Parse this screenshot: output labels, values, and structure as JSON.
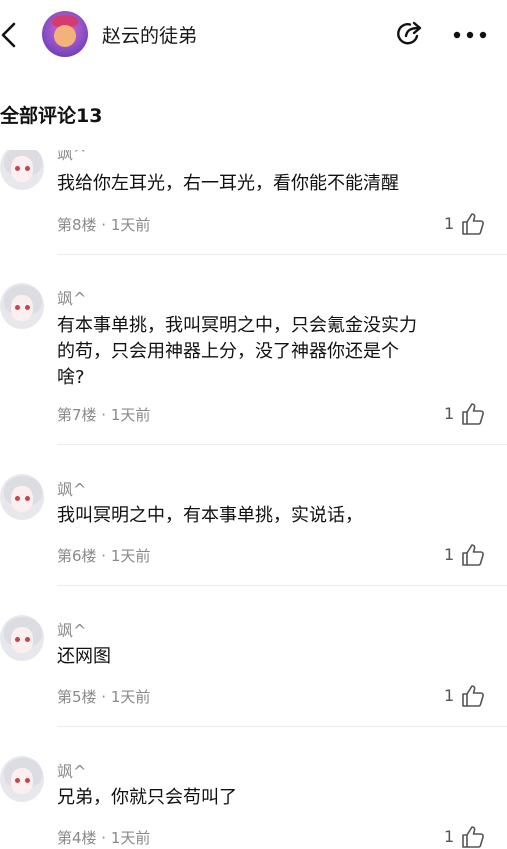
{
  "header": {
    "title": "赵云的徒弟"
  },
  "section": {
    "title": "全部评论13"
  },
  "comments": [
    {
      "user": "飒^",
      "text": "我给你左耳光，右一耳光，看你能不能清醒",
      "floor": "第8楼 · 1天前",
      "likes": "1"
    },
    {
      "user": "飒^",
      "text_lines": [
        "有本事单挑，我叫冥明之中，只会氪金没实力",
        "的苟，只会用神器上分，没了神器你还是个",
        "啥?"
      ],
      "floor": "第7楼 · 1天前",
      "likes": "1"
    },
    {
      "user": "飒^",
      "text": "我叫冥明之中，有本事单挑，实说话，",
      "floor": "第6楼 · 1天前",
      "likes": "1"
    },
    {
      "user": "飒^",
      "text": "还网图",
      "floor": "第5楼 · 1天前",
      "likes": "1"
    },
    {
      "user": "飒^",
      "text": "兄弟，你就只会苟叫了",
      "floor": "第4楼 · 1天前",
      "likes": "1"
    }
  ]
}
